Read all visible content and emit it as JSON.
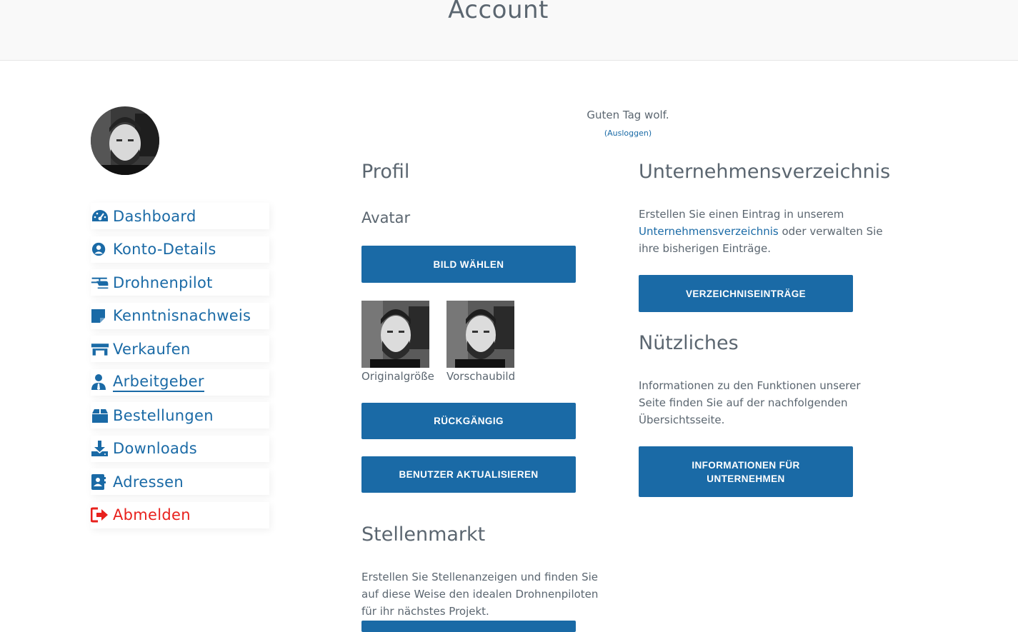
{
  "page": {
    "title": "Account"
  },
  "greeting": {
    "text": "Guten Tag wolf.",
    "logout": "(Ausloggen)"
  },
  "nav": {
    "items": [
      {
        "label": "Dashboard",
        "icon": "gauge-icon"
      },
      {
        "label": "Konto-Details",
        "icon": "user-circle-icon"
      },
      {
        "label": "Drohnenpilot",
        "icon": "helicopter-icon"
      },
      {
        "label": "Kenntnisnachweis",
        "icon": "sticky-note-icon"
      },
      {
        "label": "Verkaufen",
        "icon": "store-icon"
      },
      {
        "label": "Arbeitgeber",
        "icon": "user-tie-icon"
      },
      {
        "label": "Bestellungen",
        "icon": "box-icon"
      },
      {
        "label": "Downloads",
        "icon": "download-icon"
      },
      {
        "label": "Adressen",
        "icon": "address-book-icon"
      },
      {
        "label": "Abmelden",
        "icon": "sign-out-icon"
      }
    ],
    "active": "Arbeitgeber"
  },
  "profile": {
    "heading": "Profil",
    "avatar_heading": "Avatar",
    "choose_button": "BILD WÄHLEN",
    "thumb_original": "Originalgröße",
    "thumb_preview": "Vorschaubild",
    "undo_button": "RÜCKGÄNGIG",
    "update_button": "BENUTZER AKTUALISIEREN"
  },
  "jobs": {
    "heading": "Stellenmarkt",
    "text": "Erstellen Sie Stellenanzeigen und finden Sie auf diese Weise den idealen Drohnenpiloten für ihr nächstes Projekt."
  },
  "directory": {
    "heading": "Unternehmensverzeichnis",
    "text_before": "Erstellen Sie einen Eintrag in unserem",
    "link": "Unternehmensverzeichnis",
    "text_after": "oder verwalten Sie ihre bisherigen Einträge.",
    "button": "VERZEICHNISEINTRÄGE"
  },
  "useful": {
    "heading": "Nützliches",
    "text": "Informationen zu den Funktionen unserer Seite finden Sie auf der nachfolgenden Übersichtsseite.",
    "button": "INFORMATIONEN FÜR UNTERNEHMEN"
  },
  "colors": {
    "accent": "#1a6aa6",
    "text": "#5b6670",
    "danger": "#e8211d"
  }
}
